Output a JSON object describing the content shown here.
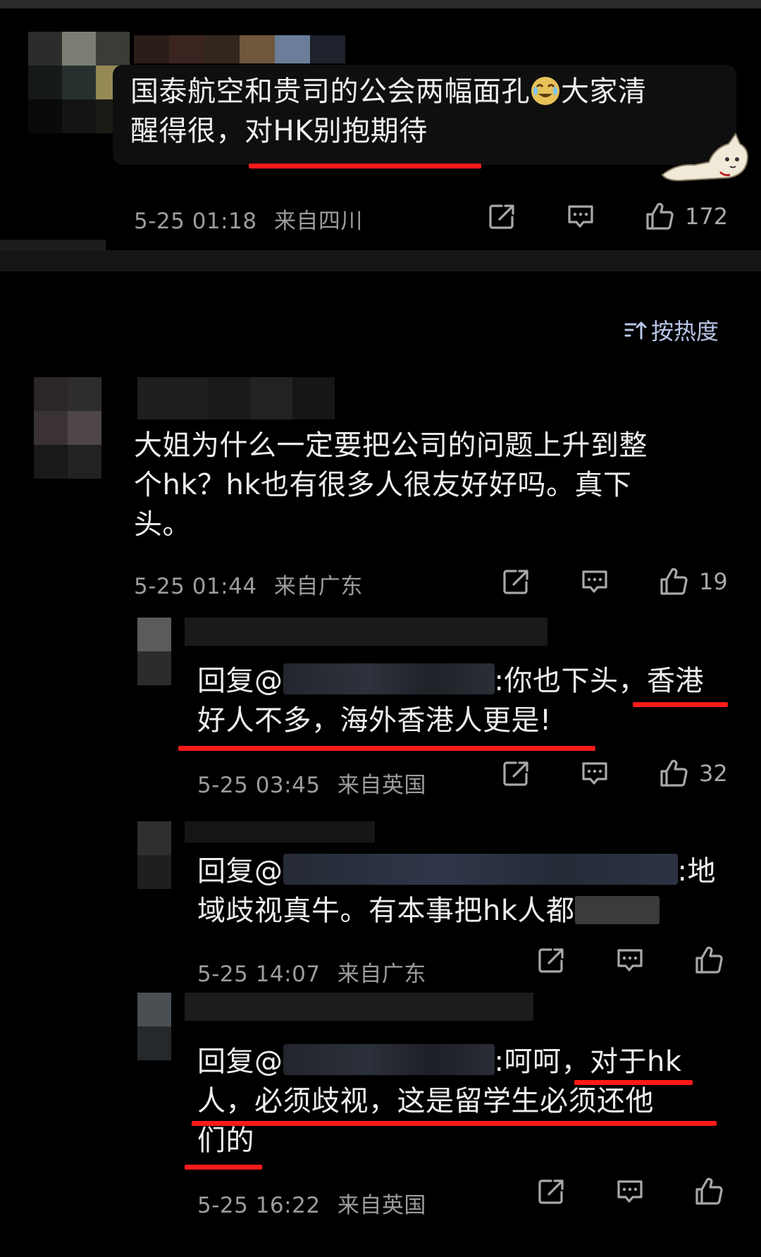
{
  "comments": [
    {
      "text_line1": "国泰航空和贵司的公会两幅面孔",
      "text_line1b": "大家清",
      "text_line2a": "醒得很，",
      "text_line2b": "对HK别抱期待",
      "time": "5-25 01:18",
      "location": "来自四川",
      "likes": "172",
      "emoji": "crying-laughing-face-icon"
    },
    {
      "text_line1": "大姐为什么一定要把公司的问题上升到整",
      "text_line2": "个hk？hk也有很多人很友好好吗。真下",
      "text_line3": "头。",
      "time": "5-25 01:44",
      "location": "来自广东",
      "likes": "19"
    }
  ],
  "sort_label": "按热度",
  "replies": [
    {
      "reply_prefix": "回复@",
      "line1_tail": ":你也下头，香港",
      "line2": "好人不多，海外香港人更是!",
      "time": "5-25 03:45",
      "location": "来自英国",
      "likes": "32"
    },
    {
      "reply_prefix": "回复@",
      "line1_tail": ":地",
      "line2": "域歧视真牛。有本事把hk人都",
      "time": "5-25 14:07",
      "location": "来自广东",
      "likes": ""
    },
    {
      "reply_prefix": "回复@",
      "line1_tail": ":呵呵，对于hk",
      "line2": "人，必须歧视，这是留学生必须还他",
      "line3": "们的",
      "time": "5-25 16:22",
      "location": "来自英国",
      "likes": ""
    }
  ],
  "colors": {
    "background": "#000000",
    "meta_text": "#9c9c9c",
    "underline": "#ff1a1a",
    "sort": "#b8c6e8"
  }
}
